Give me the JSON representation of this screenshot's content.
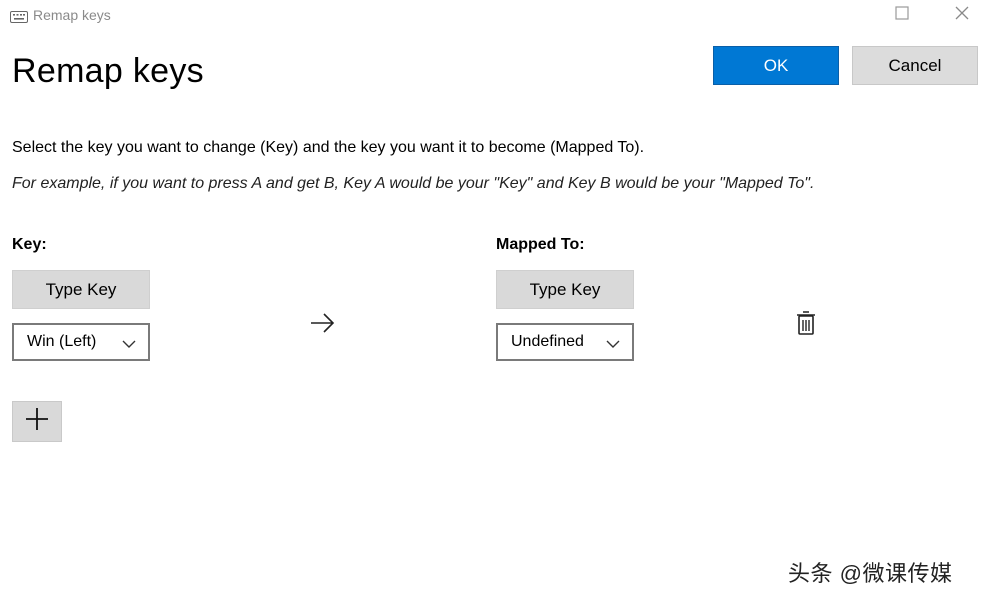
{
  "window": {
    "title": "Remap keys",
    "icon": "keyboard-icon",
    "controls": [
      "maximize-icon",
      "close-icon"
    ]
  },
  "page": {
    "title": "Remap keys",
    "instructions": "Select the key you want to change (Key) and the key you want it to become (Mapped To).",
    "example": "For example, if you want to press A and get B, Key A would be your \"Key\" and Key B would be your \"Mapped To\"."
  },
  "actions": {
    "ok_label": "OK",
    "cancel_label": "Cancel"
  },
  "columns": {
    "key_label": "Key:",
    "mapped_label": "Mapped To:"
  },
  "mapping": {
    "key_type_button": "Type Key",
    "key_value": "Win (Left)",
    "mapped_type_button": "Type Key",
    "mapped_value": "Undefined",
    "arrow_icon": "arrow-right-icon",
    "delete_icon": "trash-icon"
  },
  "add_button_icon": "plus-icon",
  "watermark": "头条 @微课传媒",
  "colors": {
    "accent": "#0078d4",
    "button_gray": "#d9d9d9",
    "background": "#ffffff"
  }
}
